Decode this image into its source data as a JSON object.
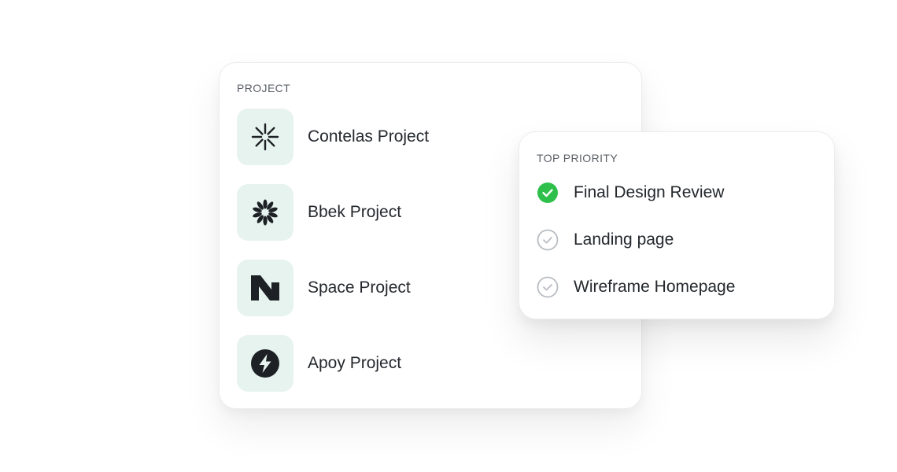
{
  "projects": {
    "label": "PROJECT",
    "items": [
      {
        "name": "Contelas Project",
        "icon": "asterisk-burst-icon"
      },
      {
        "name": "Bbek Project",
        "icon": "petal-flower-icon"
      },
      {
        "name": "Space Project",
        "icon": "n-logo-icon"
      },
      {
        "name": "Apoy Project",
        "icon": "lightning-bolt-icon"
      }
    ]
  },
  "priority": {
    "label": "TOP PRIORITY",
    "tasks": [
      {
        "label": "Final Design Review",
        "status": "done"
      },
      {
        "label": "Landing page",
        "status": "pending"
      },
      {
        "label": "Wireframe Homepage",
        "status": "pending"
      }
    ]
  },
  "colors": {
    "icon_tile": "#e7f3ee",
    "check_done": "#2ec04a",
    "check_pending": "#b8bcc2"
  }
}
